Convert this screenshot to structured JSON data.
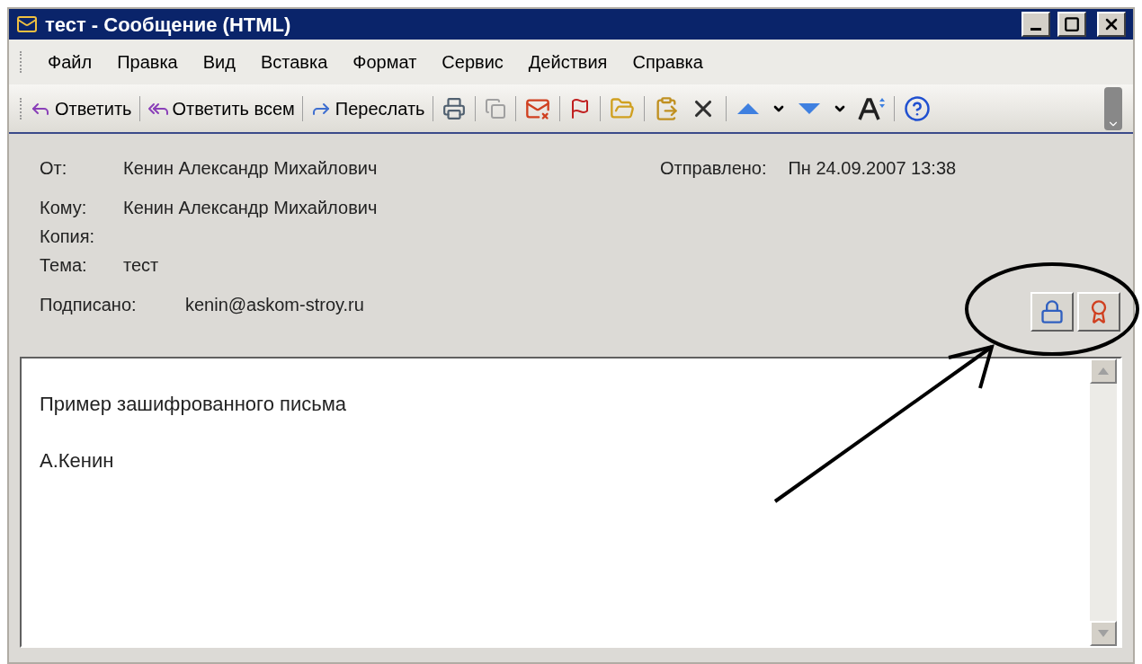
{
  "window": {
    "title": "тест - Сообщение (HTML)"
  },
  "menu": [
    "Файл",
    "Правка",
    "Вид",
    "Вставка",
    "Формат",
    "Сервис",
    "Действия",
    "Справка"
  ],
  "toolbar": {
    "labeled_buttons": [
      "Ответить",
      "Ответить всем",
      "Переслать"
    ]
  },
  "header": {
    "from": {
      "label": "От:",
      "value": "Кенин Александр Михайлович"
    },
    "sent": {
      "label": "Отправлено:",
      "value": "Пн 24.09.2007 13:38"
    },
    "to": {
      "label": "Кому:",
      "value": "Кенин Александр Михайлович"
    },
    "cc": {
      "label": "Копия:"
    },
    "subject": {
      "label": "Тема:",
      "value": "тест"
    },
    "signed": {
      "label": "Подписано:",
      "value": "kenin@askom-stroy.ru"
    }
  },
  "body": [
    "Пример зашифрованного письма",
    "А.Кенин"
  ]
}
